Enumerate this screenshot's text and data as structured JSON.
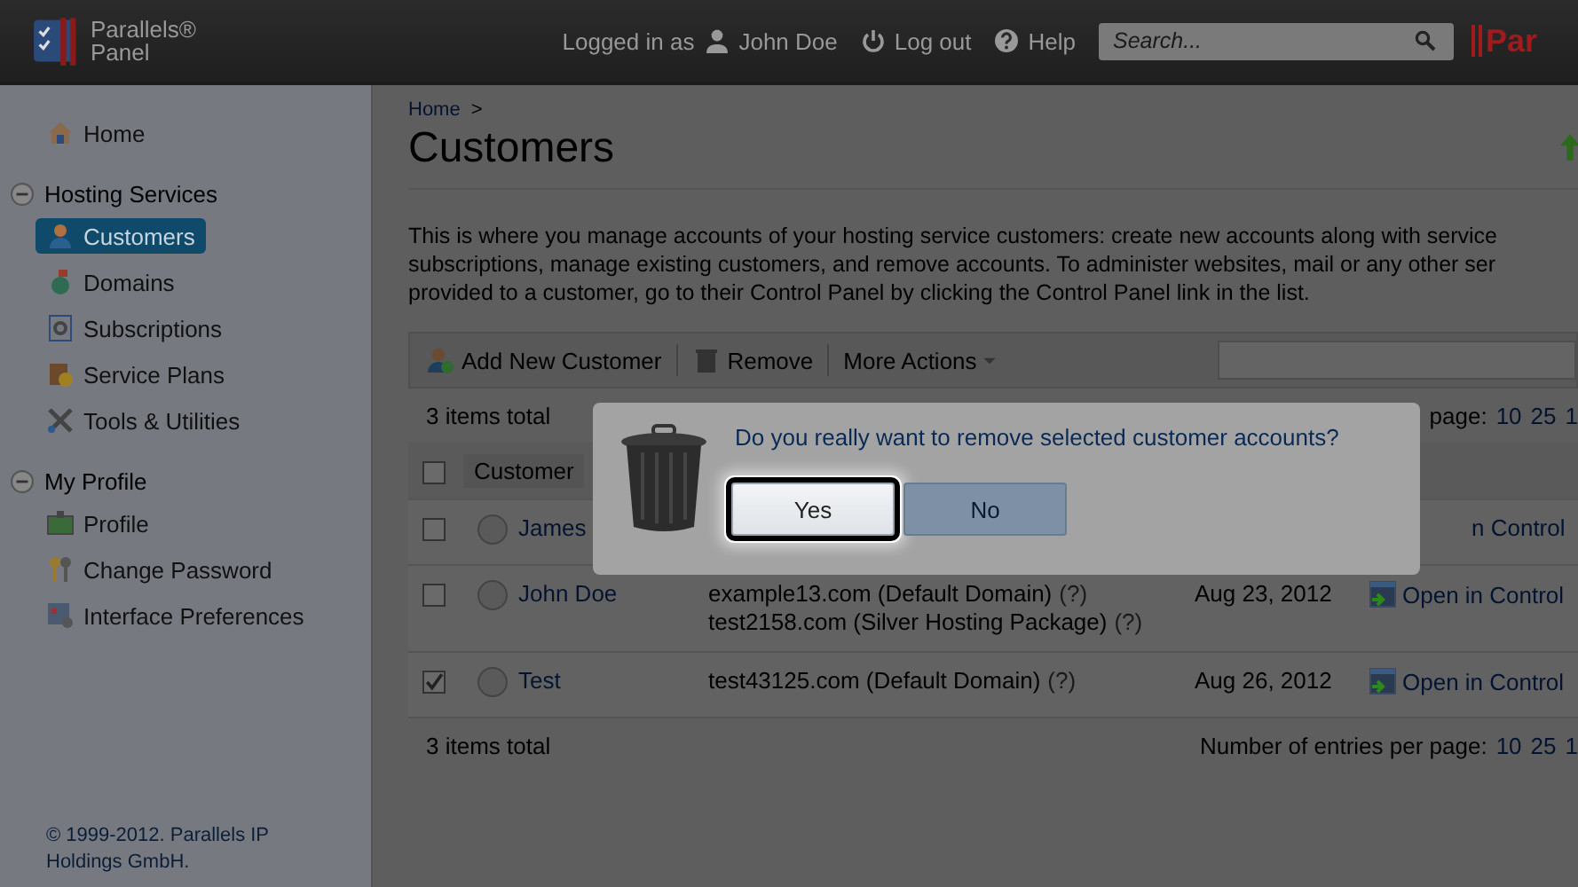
{
  "header": {
    "logo": [
      "Parallels®",
      "Panel"
    ],
    "logged_in_label": "Logged in as",
    "user": "John Doe",
    "logout": "Log out",
    "help": "Help",
    "search": {
      "placeholder": "Search..."
    },
    "brand_cut": "Par"
  },
  "sidebar": {
    "items": [
      {
        "kind": "link",
        "label": "Home",
        "selected": false
      },
      {
        "kind": "group",
        "label": "Hosting Services",
        "expanded": true,
        "children": [
          {
            "label": "Customers",
            "selected": true
          },
          {
            "label": "Domains",
            "selected": false
          },
          {
            "label": "Subscriptions",
            "selected": false
          },
          {
            "label": "Service Plans",
            "selected": false
          },
          {
            "label": "Tools & Utilities",
            "selected": false
          }
        ]
      },
      {
        "kind": "group",
        "label": "My Profile",
        "expanded": true,
        "children": [
          {
            "label": "Profile",
            "selected": false
          },
          {
            "label": "Change Password",
            "selected": false
          },
          {
            "label": "Interface Preferences",
            "selected": false
          }
        ]
      }
    ],
    "footer": "© 1999-2012. Parallels IP Holdings GmbH."
  },
  "main": {
    "breadcrumb": [
      "Home",
      ">"
    ],
    "title": "Customers",
    "description": [
      "This is where you manage accounts of your hosting service customers: create new accounts along with service",
      "subscriptions, manage existing customers, and remove accounts. To administer websites, mail or any other ser",
      "provided to a customer, go to their Control Panel by clicking the Control Panel link in the list."
    ],
    "toolbar": [
      "Add New Customer",
      "Remove",
      "More Actions"
    ],
    "total_top": "3 items total",
    "pager_top": {
      "label": "page:",
      "options": [
        "10",
        "25",
        "1"
      ]
    },
    "table": {
      "all_checked": false,
      "columns": [
        "Customer"
      ],
      "rows": [
        {
          "checked": false,
          "name": "James",
          "domains": [],
          "date": "",
          "link": "n Control"
        },
        {
          "checked": false,
          "name": "John Doe",
          "domains": [
            [
              "example13.com (Default Domain)",
              "(?)"
            ],
            [
              "test2158.com (Silver Hosting Package)",
              "(?)"
            ]
          ],
          "date": "Aug 23, 2012",
          "link": "Open in Control"
        },
        {
          "checked": true,
          "name": "Test",
          "domains": [
            [
              "test43125.com (Default Domain)",
              "(?)"
            ]
          ],
          "date": "Aug 26, 2012",
          "link": "Open in Control"
        }
      ]
    },
    "total_bottom": "3 items total",
    "pager_bottom": {
      "label": "Number of entries per page:",
      "options": [
        "10",
        "25",
        "1"
      ]
    }
  },
  "dialog": {
    "question": "Do you really want to remove selected customer accounts?",
    "buttons": [
      {
        "label": "Yes",
        "focused": true
      },
      {
        "label": "No",
        "focused": false
      }
    ]
  }
}
